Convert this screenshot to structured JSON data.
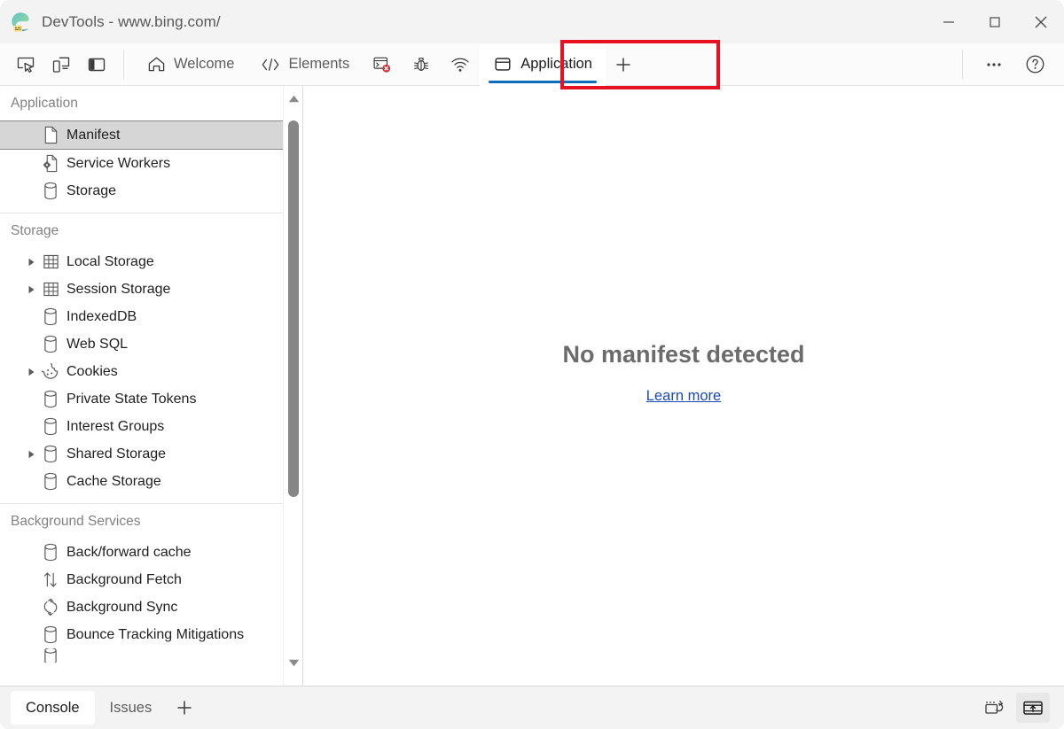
{
  "window": {
    "title": "DevTools - www.bing.com/",
    "logo_icon": "edge-devtools-logo",
    "controls": [
      {
        "name": "minimize-button",
        "icon": "minimize-icon",
        "label": "—"
      },
      {
        "name": "maximize-button",
        "icon": "maximize-icon",
        "label": "□"
      },
      {
        "name": "close-button",
        "icon": "close-icon",
        "label": "✕"
      }
    ]
  },
  "toolbar": {
    "left_icons": [
      {
        "name": "inspect-element-button",
        "icon": "inspect-cursor-icon"
      },
      {
        "name": "device-emulation-button",
        "icon": "device-toggle-icon"
      },
      {
        "name": "dock-side-button",
        "icon": "dock-panel-icon"
      }
    ],
    "tabs": [
      {
        "name": "tab-welcome",
        "label": "Welcome",
        "icon": "home-icon",
        "active": false,
        "icon_only": false
      },
      {
        "name": "tab-elements",
        "label": "Elements",
        "icon": "code-brackets-icon",
        "active": false,
        "icon_only": false
      },
      {
        "name": "tab-console",
        "label": "",
        "icon": "console-error-icon",
        "active": false,
        "icon_only": true
      },
      {
        "name": "tab-sources",
        "label": "",
        "icon": "bug-icon",
        "active": false,
        "icon_only": true
      },
      {
        "name": "tab-network",
        "label": "",
        "icon": "wifi-icon",
        "active": false,
        "icon_only": true
      },
      {
        "name": "tab-application",
        "label": "Application",
        "icon": "application-panel-icon",
        "active": true,
        "icon_only": false
      }
    ],
    "add_tab": {
      "name": "add-tab-button",
      "icon": "plus-icon"
    },
    "right_icons": [
      {
        "name": "more-options-button",
        "icon": "ellipsis-icon"
      },
      {
        "name": "help-button",
        "icon": "question-mark-icon"
      }
    ],
    "annotation": {
      "name": "application-tab-highlight",
      "color": "#e81123"
    },
    "active_tab_underline_color": "#0f6cbd"
  },
  "sidebar": {
    "groups": [
      {
        "name": "sidebar-group-application",
        "title": "Application",
        "items": [
          {
            "name": "sidebar-item-manifest",
            "label": "Manifest",
            "icon": "document-icon",
            "expandable": false,
            "selected": true
          },
          {
            "name": "sidebar-item-service-workers",
            "label": "Service Workers",
            "icon": "service-worker-icon",
            "expandable": false,
            "selected": false
          },
          {
            "name": "sidebar-item-storage",
            "label": "Storage",
            "icon": "database-icon",
            "expandable": false,
            "selected": false
          }
        ]
      },
      {
        "name": "sidebar-group-storage",
        "title": "Storage",
        "items": [
          {
            "name": "sidebar-item-local-storage",
            "label": "Local Storage",
            "icon": "table-grid-icon",
            "expandable": true,
            "selected": false
          },
          {
            "name": "sidebar-item-session-storage",
            "label": "Session Storage",
            "icon": "table-grid-icon",
            "expandable": true,
            "selected": false
          },
          {
            "name": "sidebar-item-indexeddb",
            "label": "IndexedDB",
            "icon": "database-icon",
            "expandable": false,
            "selected": false
          },
          {
            "name": "sidebar-item-web-sql",
            "label": "Web SQL",
            "icon": "database-icon",
            "expandable": false,
            "selected": false
          },
          {
            "name": "sidebar-item-cookies",
            "label": "Cookies",
            "icon": "cookie-icon",
            "expandable": true,
            "selected": false
          },
          {
            "name": "sidebar-item-private-state-tokens",
            "label": "Private State Tokens",
            "icon": "database-icon",
            "expandable": false,
            "selected": false
          },
          {
            "name": "sidebar-item-interest-groups",
            "label": "Interest Groups",
            "icon": "database-icon",
            "expandable": false,
            "selected": false
          },
          {
            "name": "sidebar-item-shared-storage",
            "label": "Shared Storage",
            "icon": "database-icon",
            "expandable": true,
            "selected": false
          },
          {
            "name": "sidebar-item-cache-storage",
            "label": "Cache Storage",
            "icon": "database-icon",
            "expandable": false,
            "selected": false
          }
        ]
      },
      {
        "name": "sidebar-group-background-services",
        "title": "Background Services",
        "items": [
          {
            "name": "sidebar-item-back-forward-cache",
            "label": "Back/forward cache",
            "icon": "database-icon",
            "expandable": false,
            "selected": false
          },
          {
            "name": "sidebar-item-background-fetch",
            "label": "Background Fetch",
            "icon": "up-down-arrows-icon",
            "expandable": false,
            "selected": false
          },
          {
            "name": "sidebar-item-background-sync",
            "label": "Background Sync",
            "icon": "sync-circular-arrows-icon",
            "expandable": false,
            "selected": false
          },
          {
            "name": "sidebar-item-bounce-tracking-mitigations",
            "label": "Bounce Tracking Mitigations",
            "icon": "database-icon",
            "expandable": false,
            "selected": false
          }
        ]
      }
    ],
    "scrollbar": {
      "name": "sidebar-scrollbar",
      "up_arrow": "scroll-up-arrow-icon",
      "down_arrow": "scroll-down-arrow-icon",
      "thumb": "scrollbar-thumb"
    }
  },
  "main": {
    "empty_state": {
      "title": "No manifest detected",
      "link_label": "Learn more",
      "link_color": "#1a49b8"
    }
  },
  "drawer": {
    "tabs": [
      {
        "name": "drawer-tab-console",
        "label": "Console",
        "active": true
      },
      {
        "name": "drawer-tab-issues",
        "label": "Issues",
        "active": false
      }
    ],
    "add_tab": {
      "name": "drawer-add-tab-button",
      "icon": "plus-icon"
    },
    "right_icons": [
      {
        "name": "restore-drawer-button",
        "icon": "restore-panel-icon",
        "highlighted": false
      },
      {
        "name": "dock-drawer-button",
        "icon": "dock-bottom-up-arrow-icon",
        "highlighted": true
      }
    ]
  }
}
